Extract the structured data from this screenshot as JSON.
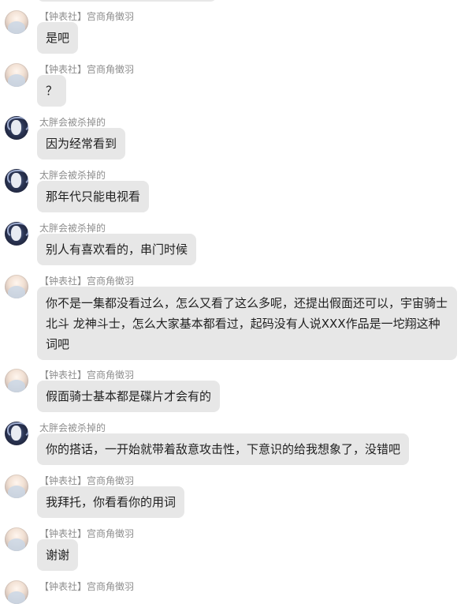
{
  "messages": [
    {
      "sender": "【钟表社】宫商角徵羽",
      "text": "是吧",
      "avatar": "light-avatar"
    },
    {
      "sender": "【钟表社】宫商角徵羽",
      "text": "？",
      "avatar": "light-avatar"
    },
    {
      "sender": "太胖会被杀掉的",
      "text": "因为经常看到",
      "avatar": "dark-avatar"
    },
    {
      "sender": "太胖会被杀掉的",
      "text": "那年代只能电视看",
      "avatar": "dark-avatar"
    },
    {
      "sender": "太胖会被杀掉的",
      "text": "别人有喜欢看的，串门时候",
      "avatar": "dark-avatar"
    },
    {
      "sender": "【钟表社】宫商角徵羽",
      "text": "你不是一集都没看过么，怎么又看了这么多呢，还提出假面还可以，宇宙骑士 北斗 龙神斗士，怎么大家基本都看过，起码没有人说XXX作品是一坨翔这种词吧",
      "avatar": "light-avatar"
    },
    {
      "sender": "【钟表社】宫商角徵羽",
      "text": "假面骑士基本都是碟片才会有的",
      "avatar": "light-avatar"
    },
    {
      "sender": "太胖会被杀掉的",
      "text": "你的搭话，一开始就带着敌意攻击性，下意识的给我想象了，没错吧",
      "avatar": "dark-avatar"
    },
    {
      "sender": "【钟表社】宫商角徵羽",
      "text": "我拜托，你看看你的用词",
      "avatar": "light-avatar"
    },
    {
      "sender": "【钟表社】宫商角徵羽",
      "text": "谢谢",
      "avatar": "light-avatar"
    },
    {
      "sender": "【钟表社】宫商角徵羽",
      "text": "",
      "avatar": "light-avatar"
    }
  ]
}
